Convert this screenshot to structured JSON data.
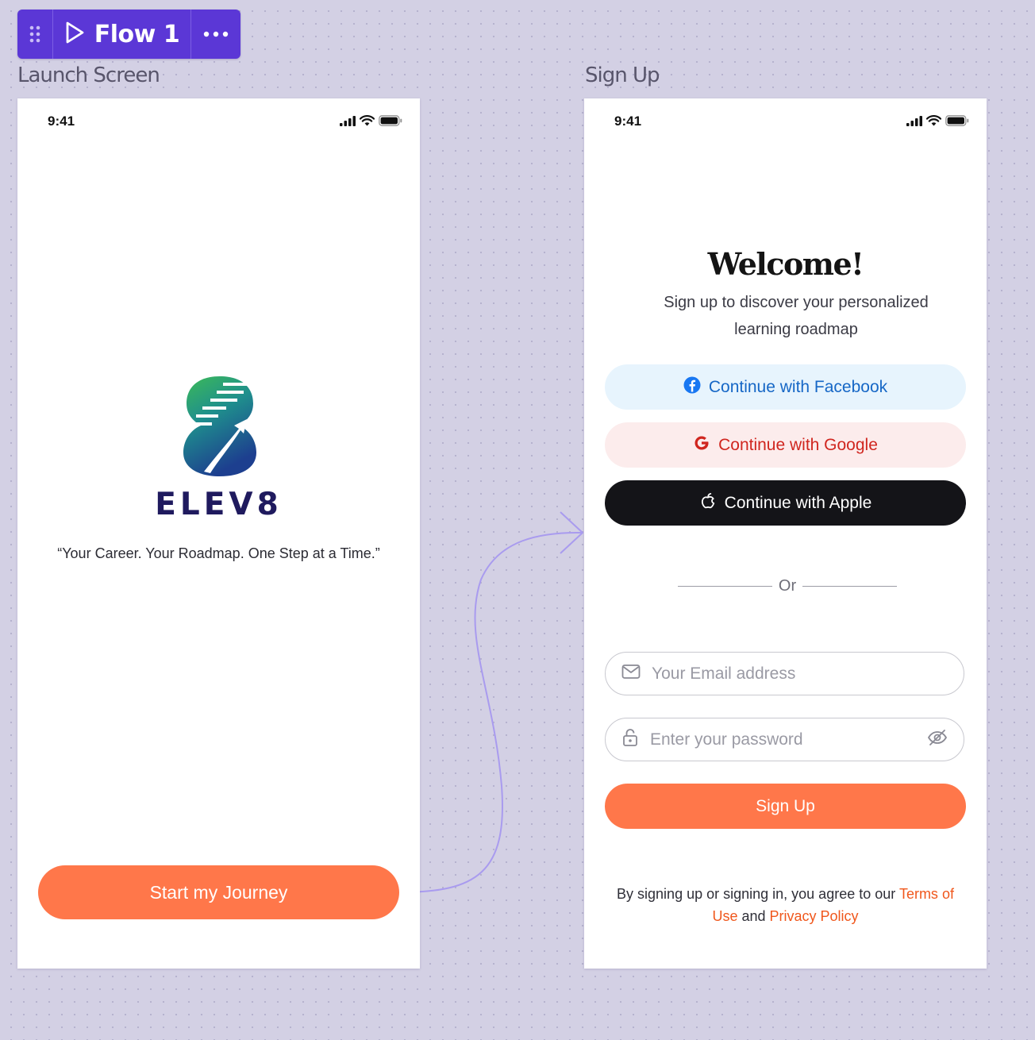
{
  "flow": {
    "label": "Flow 1",
    "grip_icon": "drag-handle-icon",
    "play_icon": "play-icon",
    "more_icon": "more-icon"
  },
  "screens": {
    "launch": {
      "label": "Launch Screen",
      "time": "9:41",
      "brand": "ELEV8",
      "tagline": "“Your Career. Your Roadmap. One Step at a Time.”",
      "cta": "Start my Journey"
    },
    "signup": {
      "label": "Sign Up",
      "time": "9:41",
      "title": "Welcome!",
      "subtitle": "Sign up to discover your personalized learning roadmap",
      "facebook": "Continue with Facebook",
      "google": "Continue with Google",
      "apple": "Continue with Apple",
      "or": "Or",
      "email_placeholder": "Your Email address",
      "password_placeholder": "Enter your password",
      "submit": "Sign Up",
      "legal_prefix": "By signing up or signing in, you agree to our ",
      "terms": "Terms of Use",
      "legal_and": " and ",
      "privacy": "Privacy Policy"
    }
  },
  "colors": {
    "accent": "#ff774a",
    "flow": "#5b37d6",
    "connector": "#a99bef",
    "link": "#f0571c"
  }
}
